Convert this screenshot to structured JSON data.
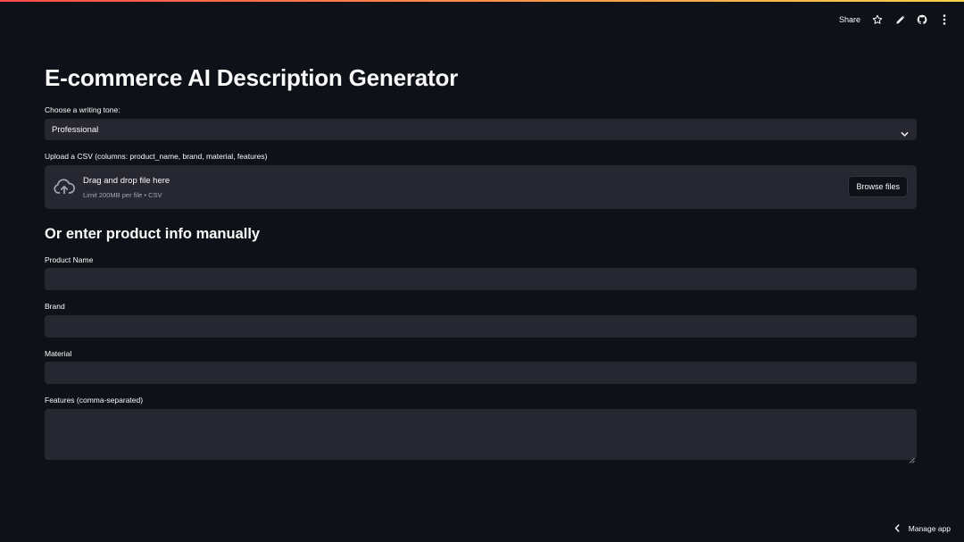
{
  "toolbar": {
    "share_label": "Share",
    "icons": [
      "star-icon",
      "pencil-icon",
      "github-icon",
      "more-vertical-icon"
    ]
  },
  "header": {
    "title": "E-commerce AI Description Generator"
  },
  "tone": {
    "label": "Choose a writing tone:",
    "selected": "Professional"
  },
  "upload": {
    "label": "Upload a CSV (columns: product_name, brand, material, features)",
    "dropzone_title": "Drag and drop file here",
    "dropzone_limit": "Limit 200MB per file • CSV",
    "browse_label": "Browse files"
  },
  "manual": {
    "heading": "Or enter product info manually",
    "product_name": {
      "label": "Product Name",
      "value": ""
    },
    "brand": {
      "label": "Brand",
      "value": ""
    },
    "material": {
      "label": "Material",
      "value": ""
    },
    "features": {
      "label": "Features (comma-separated)",
      "value": ""
    }
  },
  "footer": {
    "manage_label": "Manage app"
  },
  "colors": {
    "background": "#0e1117",
    "widget": "#262730",
    "text": "#fafafa",
    "muted": "#a3a8b4",
    "accent": "#ff4b4b"
  }
}
